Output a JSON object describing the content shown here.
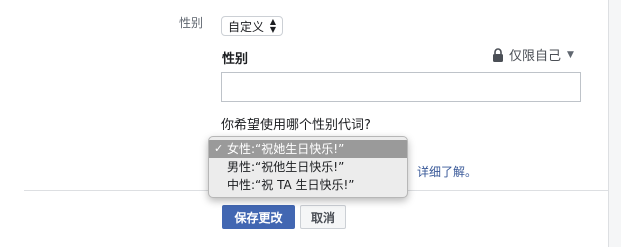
{
  "gender_row": {
    "label": "性别",
    "select_value": "自定义",
    "select_arrow_up": "▲",
    "select_arrow_down": "▼"
  },
  "custom_gender": {
    "field_label": "性别",
    "input_value": "",
    "privacy_label": "仅限自己",
    "privacy_caret": "▼"
  },
  "pronoun": {
    "question": "你希望使用哪个性别代词?",
    "learn_more": "详细了解。",
    "options": [
      {
        "label": "女性:“祝她生日快乐!”",
        "selected": true,
        "check": "✓"
      },
      {
        "label": "男性:“祝他生日快乐!”",
        "selected": false,
        "check": ""
      },
      {
        "label": "中性:“祝 TA 生日快乐!”",
        "selected": false,
        "check": ""
      }
    ]
  },
  "actions": {
    "save_label": "保存更改",
    "cancel_label": "取消"
  },
  "colors": {
    "accent": "#4267b2",
    "link": "#385898"
  }
}
